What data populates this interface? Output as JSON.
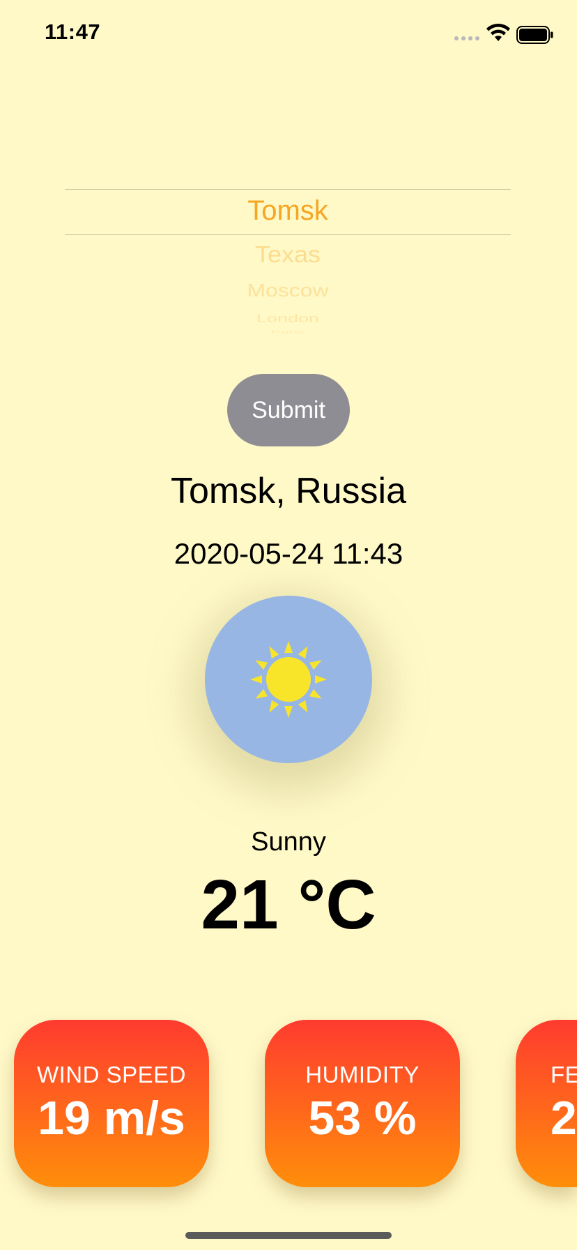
{
  "status_bar": {
    "time": "11:47"
  },
  "picker": {
    "items": [
      "Tomsk",
      "Texas",
      "Moscow",
      "London",
      "Paris"
    ],
    "selected": "Tomsk",
    "accent_color": "#F6A623"
  },
  "submit_label": "Submit",
  "weather": {
    "location": "Tomsk, Russia",
    "datetime": "2020-05-24 11:43",
    "icon": "sun-icon",
    "condition": "Sunny",
    "temperature": "21 °C"
  },
  "cards": [
    {
      "title": "WIND SPEED",
      "value": "19 m/s"
    },
    {
      "title": "HUMIDITY",
      "value": "53 %"
    },
    {
      "title": "FE",
      "value": "2"
    }
  ],
  "colors": {
    "background": "#FFF9C8",
    "card_gradient_top": "#FF3B2F",
    "card_gradient_bottom": "#FF8E0A",
    "icon_circle": "#98B6E4",
    "button": "#8E8D93"
  }
}
